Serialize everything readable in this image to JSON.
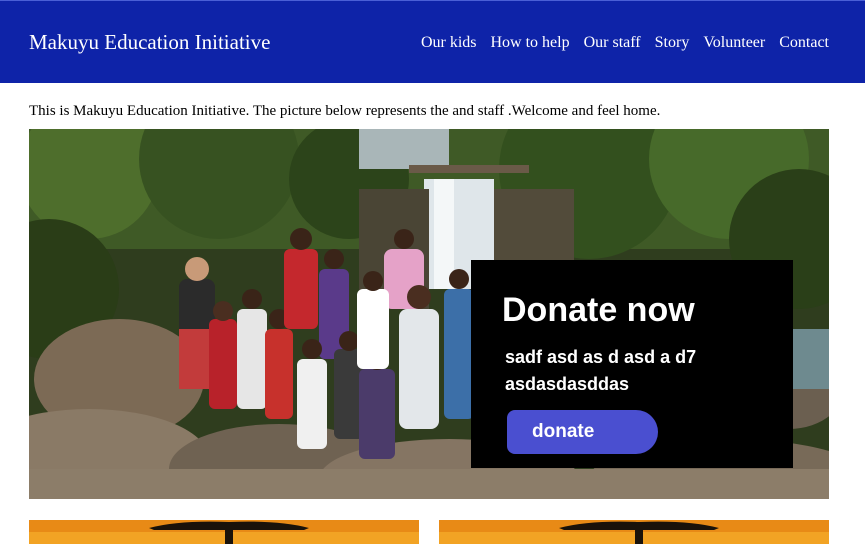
{
  "header": {
    "brand": "Makuyu Education Initiative",
    "nav": [
      "Our kids",
      "How to help",
      "Our staff",
      "Story",
      "Volunteer",
      "Contact"
    ]
  },
  "intro_text": "This is Makuyu Education Initiative. The picture below represents the and staff .Welcome and feel home.",
  "hero": {
    "image_icon": "group-photo-waterfall",
    "donate": {
      "title": "Donate now",
      "text": "sadf asd as d asd a d7 asdasdasddas",
      "button_label": "donate"
    }
  },
  "cards": [
    {
      "image_icon": "sunset-tree-photo"
    },
    {
      "image_icon": "sunset-tree-photo"
    }
  ],
  "colors": {
    "header_bg": "#0e23a8",
    "donate_bg": "#000000",
    "donate_button": "#4a4fd0"
  }
}
